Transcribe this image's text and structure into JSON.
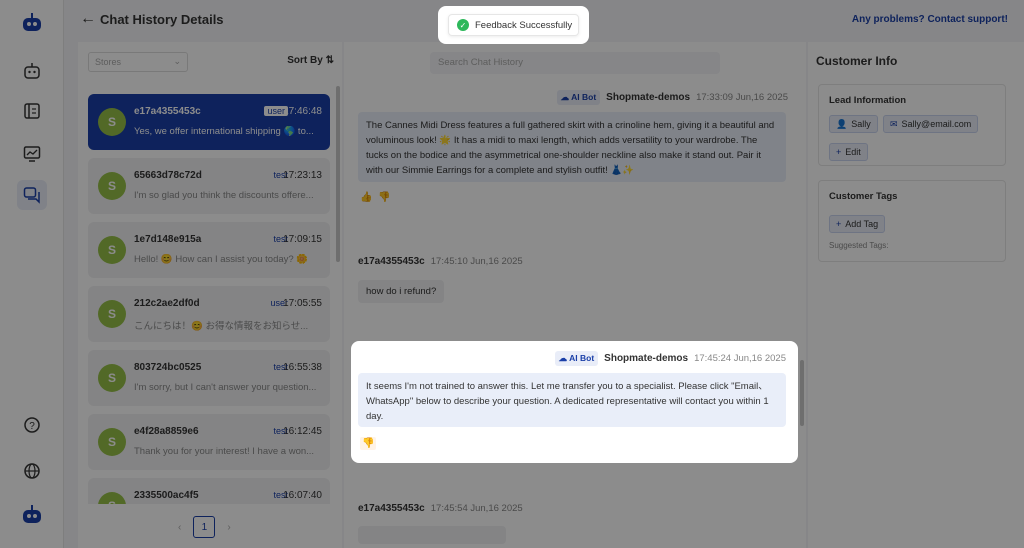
{
  "header": {
    "title": "Chat History Details",
    "contact_link": "Any problems? Contact support!"
  },
  "toast": {
    "message": "Feedback Successfully"
  },
  "list": {
    "stores_placeholder": "Stores",
    "sort_label": "Sort By",
    "conversations": [
      {
        "id": "e17a4355453c",
        "tag": "user",
        "time": "17:46:48",
        "preview": "Yes, we offer international shipping 🌎 to..."
      },
      {
        "id": "65663d78c72d",
        "tag": "test",
        "time": "17:23:13",
        "preview": "I'm so glad you think the discounts offere..."
      },
      {
        "id": "1e7d148e915a",
        "tag": "test",
        "time": "17:09:15",
        "preview": "Hello! 😊 How can I assist you today? 🌼"
      },
      {
        "id": "212c2ae2df0d",
        "tag": "user",
        "time": "17:05:55",
        "preview": "こんにちは！😊 お得な情報をお知らせ..."
      },
      {
        "id": "803724bc0525",
        "tag": "test",
        "time": "16:55:38",
        "preview": "I'm sorry, but I can't answer your question..."
      },
      {
        "id": "e4f28a8859e6",
        "tag": "test",
        "time": "16:12:45",
        "preview": "Thank you for your interest! I have a won..."
      },
      {
        "id": "2335500ac4f5",
        "tag": "test",
        "time": "16:07:40",
        "preview": ""
      }
    ],
    "page": "1"
  },
  "chat": {
    "search_placeholder": "Search Chat History",
    "ai_badge": "AI Bot",
    "messages": [
      {
        "sender": "Shopmate-demos",
        "time": "17:33:09 Jun,16 2025",
        "text": "The Cannes Midi Dress features a full gathered skirt with a crinoline hem, giving it a beautiful and voluminous look! 🌟 It has a midi to maxi length, which adds versatility to your wardrobe. The tucks on the bodice and the asymmetrical one-shoulder neckline also make it stand out. Pair it with our Simmie Earrings for a complete and stylish outfit! 👗✨"
      },
      {
        "sender": "e17a4355453c",
        "time": "17:45:10 Jun,16 2025",
        "text": "how do i refund?"
      },
      {
        "sender": "Shopmate-demos",
        "time": "17:45:24 Jun,16 2025",
        "text": "It seems I'm not trained to answer this. Let me transfer you to a specialist. Please click \"Email、WhatsApp\" below to describe your question. A dedicated representative will contact you within 1 day."
      },
      {
        "sender": "e17a4355453c",
        "time": "17:45:54 Jun,16 2025",
        "text": ""
      }
    ]
  },
  "customer": {
    "title": "Customer Info",
    "lead_title": "Lead Information",
    "name": "Sally",
    "email": "Sally@email.com",
    "edit_label": "Edit",
    "tags_title": "Customer Tags",
    "add_tag_label": "Add Tag",
    "suggested_label": "Suggested Tags:"
  },
  "colors": {
    "accent": "#1a3fa8",
    "success": "#2db85b",
    "shopify_green": "#96bf48"
  }
}
